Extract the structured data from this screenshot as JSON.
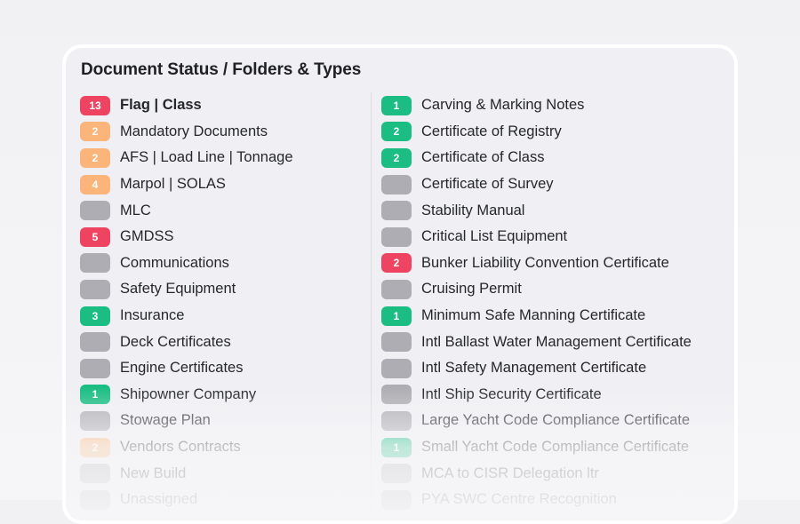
{
  "panel": {
    "title": "Document Status / Folders & Types",
    "left_items": [
      {
        "label": "Flag | Class",
        "count": "13",
        "status": "red",
        "bold": true
      },
      {
        "label": "Mandatory Documents",
        "count": "2",
        "status": "orange"
      },
      {
        "label": "AFS | Load Line | Tonnage",
        "count": "2",
        "status": "orange"
      },
      {
        "label": "Marpol | SOLAS",
        "count": "4",
        "status": "orange"
      },
      {
        "label": "MLC",
        "count": "",
        "status": "gray"
      },
      {
        "label": "GMDSS",
        "count": "5",
        "status": "red"
      },
      {
        "label": "Communications",
        "count": "",
        "status": "gray"
      },
      {
        "label": "Safety Equipment",
        "count": "",
        "status": "gray"
      },
      {
        "label": "Insurance",
        "count": "3",
        "status": "green"
      },
      {
        "label": "Deck Certificates",
        "count": "",
        "status": "gray"
      },
      {
        "label": "Engine Certificates",
        "count": "",
        "status": "gray"
      },
      {
        "label": "Shipowner Company",
        "count": "1",
        "status": "green"
      },
      {
        "label": "Stowage Plan",
        "count": "",
        "status": "gray"
      },
      {
        "label": "Vendors Contracts",
        "count": "2",
        "status": "orange"
      },
      {
        "label": "New Build",
        "count": "",
        "status": "gray"
      },
      {
        "label": "Unassigned",
        "count": "",
        "status": "gray"
      }
    ],
    "right_items": [
      {
        "label": "Carving & Marking Notes",
        "count": "1",
        "status": "green"
      },
      {
        "label": "Certificate of Registry",
        "count": "2",
        "status": "green"
      },
      {
        "label": "Certificate of Class",
        "count": "2",
        "status": "green"
      },
      {
        "label": "Certificate of Survey",
        "count": "",
        "status": "gray"
      },
      {
        "label": "Stability Manual",
        "count": "",
        "status": "gray"
      },
      {
        "label": "Critical List Equipment",
        "count": "",
        "status": "gray"
      },
      {
        "label": "Bunker Liability Convention Certificate",
        "count": "2",
        "status": "red"
      },
      {
        "label": "Cruising Permit",
        "count": "",
        "status": "gray"
      },
      {
        "label": "Minimum Safe Manning Certificate",
        "count": "1",
        "status": "green"
      },
      {
        "label": "Intl Ballast Water Management Certificate",
        "count": "",
        "status": "gray"
      },
      {
        "label": "Intl Safety Management Certificate",
        "count": "",
        "status": "gray"
      },
      {
        "label": "Intl Ship Security Certificate",
        "count": "",
        "status": "gray"
      },
      {
        "label": "Large Yacht Code Compliance Certificate",
        "count": "",
        "status": "gray"
      },
      {
        "label": "Small Yacht Code Compliance Certificate",
        "count": "1",
        "status": "green"
      },
      {
        "label": "MCA to CISR Delegation ltr",
        "count": "",
        "status": "gray"
      },
      {
        "label": "PYA SWC Centre Recognition",
        "count": "",
        "status": "gray"
      }
    ]
  },
  "colors": {
    "red": "#ee4461",
    "orange": "#fbb57a",
    "green": "#1bbd83",
    "gray": "#adadb3"
  }
}
